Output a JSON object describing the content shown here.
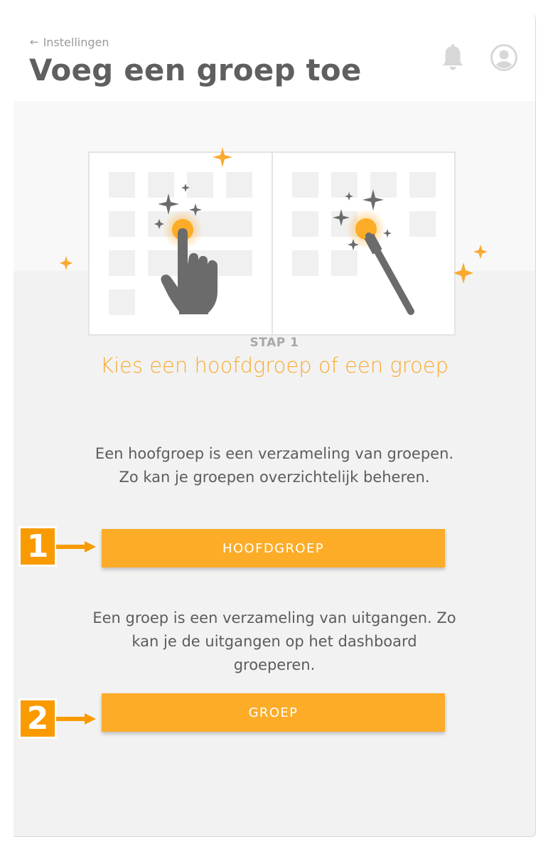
{
  "header": {
    "back_label": "Instellingen",
    "title": "Voeg een groep toe",
    "icons": [
      "bell-icon",
      "user-icon"
    ]
  },
  "step": {
    "label": "STAP 1",
    "title": "Kies een hoofdgroep of een groep"
  },
  "options": [
    {
      "description": "Een hoofgroep is een verzameling van groepen. Zo kan je groepen overzichtelijk beheren.",
      "button_label": "HOOFDGROEP",
      "badge": "1"
    },
    {
      "description": "Een groep is een verzameling van uitgangen. Zo kan je de uitgangen op het dashboard groeperen.",
      "button_label": "GROEP",
      "badge": "2"
    }
  ],
  "colors": {
    "accent": "#fcac27",
    "title_accent": "#f9aa30",
    "badge": "#f99a00",
    "text": "#5c5c5c",
    "muted": "#9a9a9a",
    "icon": "#6b6b6b"
  }
}
